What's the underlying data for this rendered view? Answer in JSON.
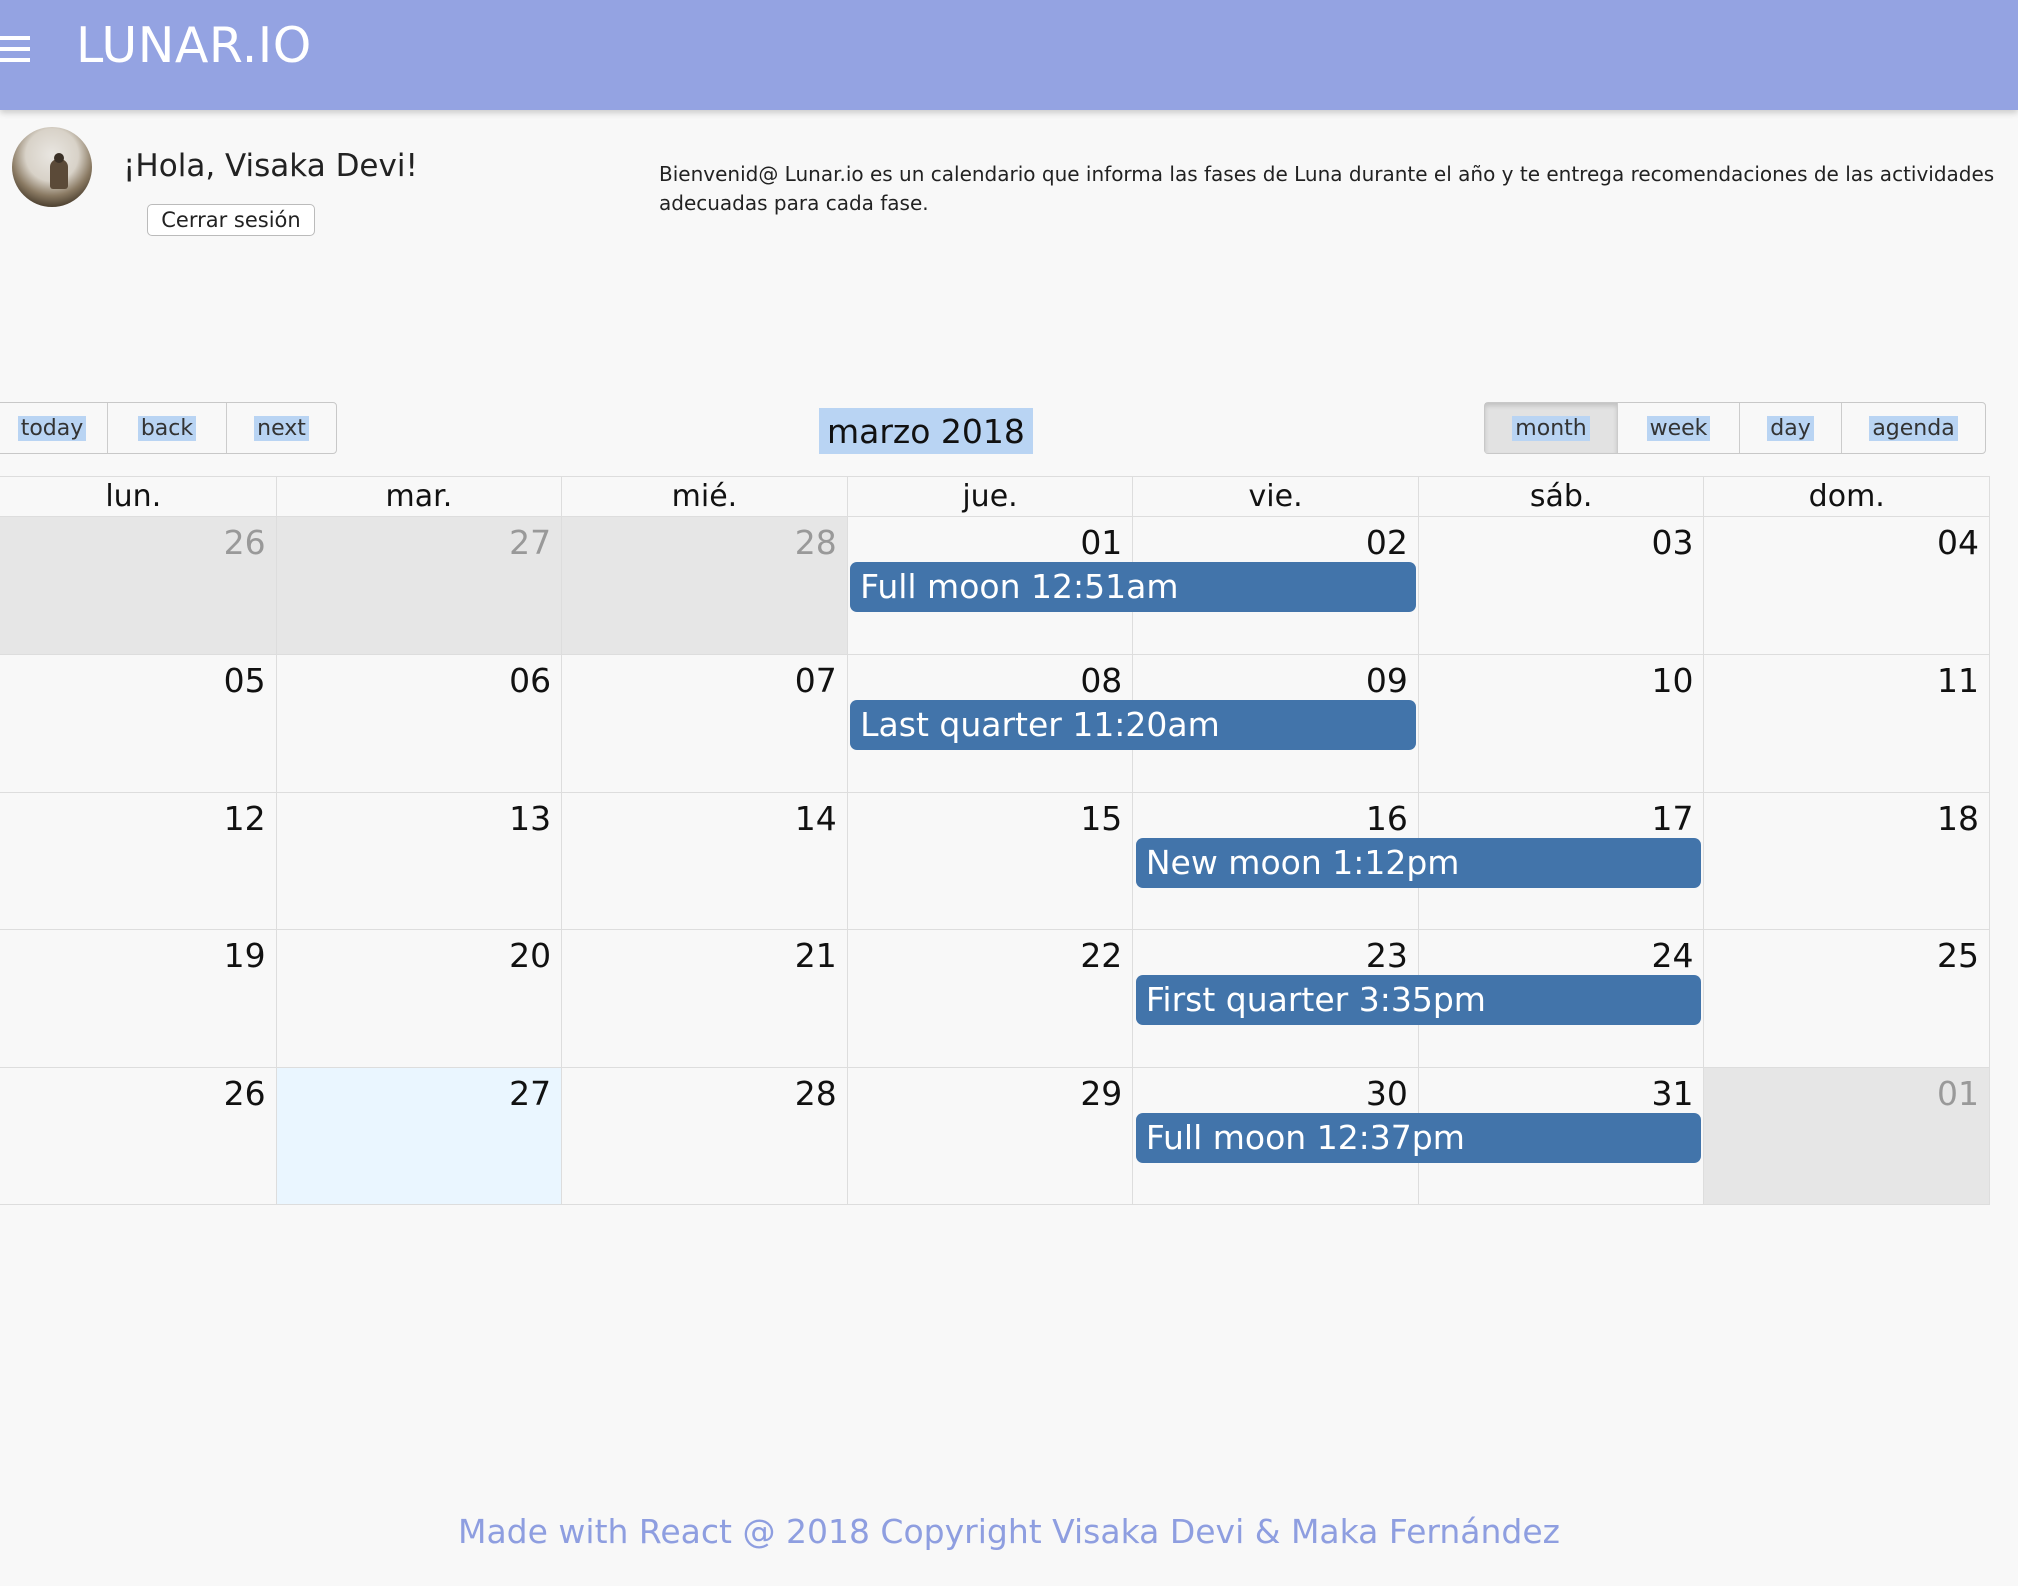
{
  "app": {
    "brand": "LUNAR.IO"
  },
  "user": {
    "greeting": "¡Hola, Visaka Devi!",
    "logout_label": "Cerrar sesión"
  },
  "welcome_text": "Bienvenid@ Lunar.io es un calendario que informa las fases de Luna durante el año y te entrega recomendaciones de las actividades adecuadas para cada fase.",
  "toolbar": {
    "nav": [
      "today",
      "back",
      "next"
    ],
    "label": "marzo 2018",
    "views": [
      "month",
      "week",
      "day",
      "agenda"
    ],
    "active_view": "month"
  },
  "calendar": {
    "weekdays": [
      "lun.",
      "mar.",
      "mié.",
      "jue.",
      "vie.",
      "sáb.",
      "dom."
    ],
    "weeks": [
      {
        "days": [
          "26",
          "27",
          "28",
          "01",
          "02",
          "03",
          "04"
        ],
        "off": [
          0,
          1,
          2
        ],
        "event": {
          "title": "Full moon 12:51am",
          "start": 3,
          "span": 2
        }
      },
      {
        "days": [
          "05",
          "06",
          "07",
          "08",
          "09",
          "10",
          "11"
        ],
        "off": [],
        "event": {
          "title": "Last quarter 11:20am",
          "start": 3,
          "span": 2
        }
      },
      {
        "days": [
          "12",
          "13",
          "14",
          "15",
          "16",
          "17",
          "18"
        ],
        "off": [],
        "event": {
          "title": "New moon 1:12pm",
          "start": 4,
          "span": 2
        }
      },
      {
        "days": [
          "19",
          "20",
          "21",
          "22",
          "23",
          "24",
          "25"
        ],
        "off": [],
        "event": {
          "title": "First quarter 3:35pm",
          "start": 4,
          "span": 2
        }
      },
      {
        "days": [
          "26",
          "27",
          "28",
          "29",
          "30",
          "31",
          "01"
        ],
        "off": [
          6
        ],
        "today": 1,
        "event": {
          "title": "Full moon 12:37pm",
          "start": 4,
          "span": 2
        }
      }
    ],
    "colors": {
      "event": "#4274aa",
      "off_range": "#e6e6e6",
      "today": "#eaf6ff"
    }
  },
  "footer": "Made with React @ 2018 Copyright Visaka Devi & Maka Fernández",
  "colors": {
    "topbar": "#94a3e2",
    "footer_text": "#8e9ee0",
    "selection": "#b9d4f3"
  }
}
